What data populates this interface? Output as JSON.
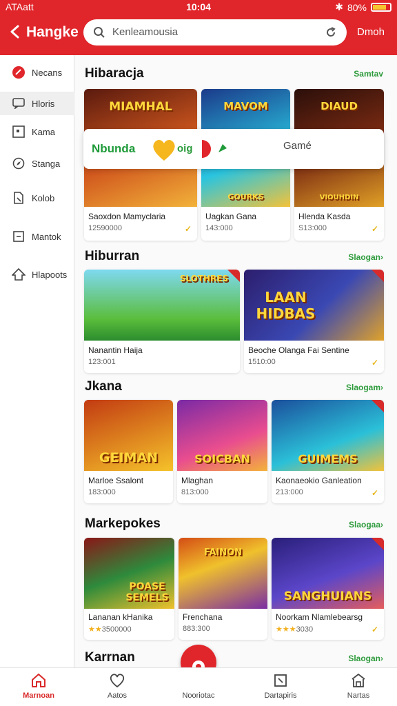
{
  "status_bar": {
    "carrier": "ATAatt",
    "time": "10:04",
    "battery": "80%",
    "battery_level": 0.8
  },
  "header": {
    "title": "Hangke",
    "search_placeholder": "Kenleamousia",
    "action": "Dmoh"
  },
  "sidebar": {
    "items": [
      {
        "label": "Necans",
        "icon": "badge-icon"
      },
      {
        "label": "Hloris",
        "icon": "message-icon"
      },
      {
        "label": "Kama",
        "icon": "square-icon"
      },
      {
        "label": "Stanga",
        "icon": "compass-icon"
      },
      {
        "label": "Kolob",
        "icon": "bookmark-icon"
      },
      {
        "label": "Mantok",
        "icon": "box-icon"
      },
      {
        "label": "Hlapoots",
        "icon": "cube-icon"
      }
    ]
  },
  "popup": {
    "text": "Nbunda",
    "text2": "oig",
    "button": "Gamé"
  },
  "sections": [
    {
      "title": "Hibaracja",
      "link": "Samtav",
      "cards": [
        {
          "name": "Saoxdon Mamyclaria",
          "price": "12590000",
          "top_text": "MIAMHAL",
          "bottom_text": "",
          "colors": [
            "#5a1a0e",
            "#d1581e"
          ]
        },
        {
          "name": "Uagkan Gana",
          "price": "143:000",
          "top_text": "MAVOM",
          "bottom_text": "GOURKS",
          "colors": [
            "#1b3a8a",
            "#29c4e0"
          ]
        },
        {
          "name": "Hlenda Kasda",
          "price": "S13:000",
          "top_text": "DIAUD",
          "bottom_text": "VIOUHDIN",
          "colors": [
            "#2b0f0a",
            "#e1a026"
          ]
        }
      ]
    },
    {
      "title": "Hiburran",
      "link": "Slaogan›",
      "cards": [
        {
          "name": "Nanantin Haija",
          "price": "123:001",
          "top_text": "SLOTHRES",
          "colors": [
            "#2b8c2e",
            "#7ed9f0"
          ]
        },
        {
          "name": "Beoche Olanga Fai Sentine",
          "price": "1510:00",
          "top_text": "LAAN HIDBAS",
          "colors": [
            "#2c1e6d",
            "#e0a22a"
          ]
        }
      ]
    },
    {
      "title": "Jkana",
      "link": "Slaogam›",
      "cards": [
        {
          "name": "Marloe Ssalont",
          "price": "183:000",
          "top_text": "GEIMAN",
          "colors": [
            "#c23b12",
            "#f5c22a"
          ]
        },
        {
          "name": "Mlaghan",
          "price": "813:000",
          "top_text": "SOICBAN",
          "colors": [
            "#7a2aa5",
            "#e94d8f"
          ]
        },
        {
          "name": "Kaonaeokio Ganleation",
          "price": "213:000",
          "top_text": "GUIMEMS",
          "colors": [
            "#1b4f9c",
            "#2bc0d8"
          ]
        }
      ]
    },
    {
      "title": "Markepokes",
      "link": "Slaogaa›",
      "cards": [
        {
          "name": "Lananan kHanika",
          "price": "3500000",
          "stars": "★★",
          "top_text": "POASE SEMELS",
          "colors": [
            "#8a1717",
            "#f0c12c"
          ]
        },
        {
          "name": "Frenchana",
          "price": "883:300",
          "top_text": "FAINON",
          "colors": [
            "#d44c15",
            "#7b2da3"
          ]
        },
        {
          "name": "Noorkam Nlamlebearsg",
          "price": "3030",
          "stars": "★★★",
          "top_text": "SANGHUIANS",
          "colors": [
            "#2a1f7a",
            "#e55d5d"
          ]
        }
      ]
    },
    {
      "title": "Karrnan",
      "link": "Slaogan›",
      "cards": []
    }
  ],
  "bottom_nav": [
    {
      "label": "Marnoan",
      "icon": "home-icon",
      "active": true
    },
    {
      "label": "Aatos",
      "icon": "heart-icon",
      "active": false
    },
    {
      "label": "Nooriotac",
      "icon": "center-icon",
      "active": false
    },
    {
      "label": "Dartapiris",
      "icon": "box-icon",
      "active": false
    },
    {
      "label": "Nartas",
      "icon": "store-icon",
      "active": false
    }
  ]
}
